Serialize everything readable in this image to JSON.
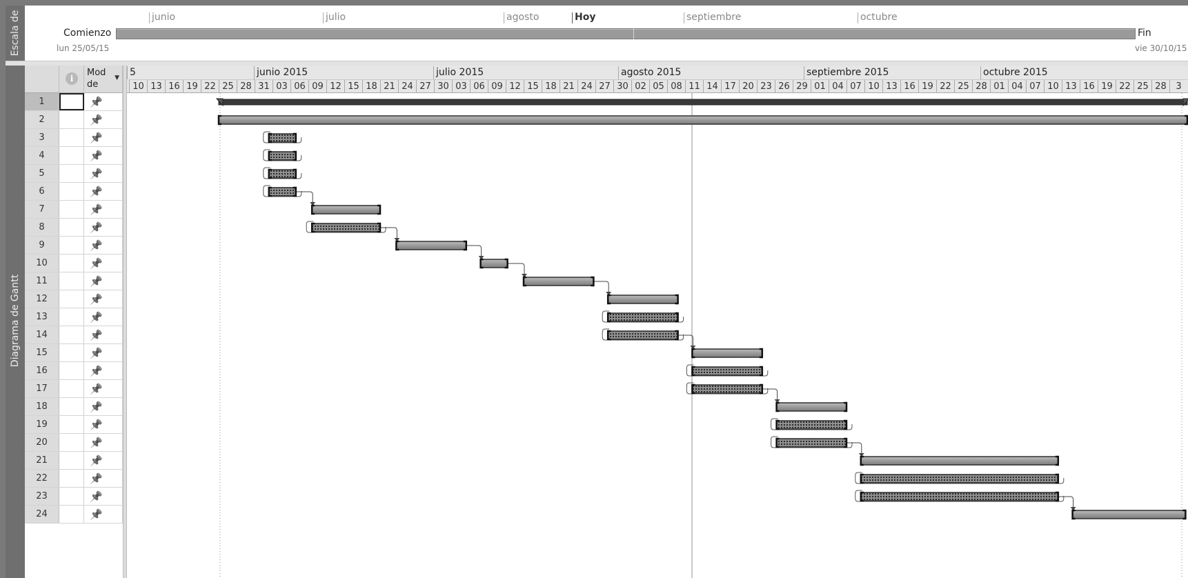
{
  "timeline": {
    "sidebar_label": "Escala de",
    "months": [
      "junio",
      "julio",
      "agosto",
      "septiembre",
      "octubre"
    ],
    "today_label": "Hoy",
    "start_label": "Comienzo",
    "start_date": "lun 25/05/15",
    "end_label": "Fin",
    "end_date": "vie 30/10/15"
  },
  "gantt": {
    "sidebar_label": "Diagrama de Gantt",
    "table": {
      "info_header": "i",
      "mode_header": "Mod de",
      "rows": [
        {
          "id": "1"
        },
        {
          "id": "2"
        },
        {
          "id": "3"
        },
        {
          "id": "4"
        },
        {
          "id": "5"
        },
        {
          "id": "6"
        },
        {
          "id": "7"
        },
        {
          "id": "8"
        },
        {
          "id": "9"
        },
        {
          "id": "10"
        },
        {
          "id": "11"
        },
        {
          "id": "12"
        },
        {
          "id": "13"
        },
        {
          "id": "14"
        },
        {
          "id": "15"
        },
        {
          "id": "16"
        },
        {
          "id": "17"
        },
        {
          "id": "18"
        },
        {
          "id": "19"
        },
        {
          "id": "20"
        },
        {
          "id": "21"
        },
        {
          "id": "22"
        },
        {
          "id": "23"
        },
        {
          "id": "24"
        }
      ]
    },
    "month_headers": [
      "5",
      "junio 2015",
      "julio 2015",
      "agosto 2015",
      "septiembre 2015",
      "octubre 2015"
    ],
    "day_headers": [
      "10",
      "13",
      "16",
      "19",
      "22",
      "25",
      "28",
      "31",
      "03",
      "06",
      "09",
      "12",
      "15",
      "18",
      "21",
      "24",
      "27",
      "30",
      "03",
      "06",
      "09",
      "12",
      "15",
      "18",
      "21",
      "24",
      "27",
      "30",
      "02",
      "05",
      "08",
      "11",
      "14",
      "17",
      "20",
      "23",
      "26",
      "29",
      "01",
      "04",
      "07",
      "10",
      "13",
      "16",
      "19",
      "22",
      "25",
      "28",
      "01",
      "04",
      "07",
      "10",
      "13",
      "16",
      "19",
      "22",
      "25",
      "28",
      "3"
    ],
    "today_day_index": 31,
    "project_start_day_index": 5,
    "tasks": [
      {
        "row": 1,
        "type": "summary",
        "start": 5,
        "end": 59
      },
      {
        "row": 2,
        "type": "task",
        "start": 5,
        "end": 59
      },
      {
        "row": 3,
        "type": "dotted",
        "start": 7.8,
        "end": 9.3
      },
      {
        "row": 4,
        "type": "dotted",
        "start": 7.8,
        "end": 9.3
      },
      {
        "row": 5,
        "type": "dotted",
        "start": 7.8,
        "end": 9.3
      },
      {
        "row": 6,
        "type": "dotted",
        "start": 7.8,
        "end": 9.3
      },
      {
        "row": 7,
        "type": "task",
        "start": 10.2,
        "end": 14.0
      },
      {
        "row": 8,
        "type": "dotted",
        "start": 10.2,
        "end": 14.0
      },
      {
        "row": 9,
        "type": "task",
        "start": 14.9,
        "end": 18.8
      },
      {
        "row": 10,
        "type": "task",
        "start": 19.6,
        "end": 21.1
      },
      {
        "row": 11,
        "type": "task",
        "start": 22.0,
        "end": 25.9
      },
      {
        "row": 12,
        "type": "task",
        "start": 26.7,
        "end": 30.6
      },
      {
        "row": 13,
        "type": "dotted",
        "start": 26.7,
        "end": 30.6
      },
      {
        "row": 14,
        "type": "dotted",
        "start": 26.7,
        "end": 30.6
      },
      {
        "row": 15,
        "type": "task",
        "start": 31.4,
        "end": 35.3
      },
      {
        "row": 16,
        "type": "dotted",
        "start": 31.4,
        "end": 35.3
      },
      {
        "row": 17,
        "type": "dotted",
        "start": 31.4,
        "end": 35.3
      },
      {
        "row": 18,
        "type": "task",
        "start": 36.1,
        "end": 40.0
      },
      {
        "row": 19,
        "type": "dotted",
        "start": 36.1,
        "end": 40.0
      },
      {
        "row": 20,
        "type": "dotted",
        "start": 36.1,
        "end": 40.0
      },
      {
        "row": 21,
        "type": "task",
        "start": 40.8,
        "end": 51.8
      },
      {
        "row": 22,
        "type": "dotted",
        "start": 40.8,
        "end": 51.8
      },
      {
        "row": 23,
        "type": "dotted",
        "start": 40.8,
        "end": 51.8
      },
      {
        "row": 24,
        "type": "task",
        "start": 52.6,
        "end": 58.9
      }
    ],
    "links": [
      {
        "from": 6,
        "to": 7
      },
      {
        "from": 8,
        "to": 9
      },
      {
        "from": 9,
        "to": 10
      },
      {
        "from": 10,
        "to": 11
      },
      {
        "from": 11,
        "to": 12
      },
      {
        "from": 14,
        "to": 15
      },
      {
        "from": 17,
        "to": 18
      },
      {
        "from": 20,
        "to": 21
      },
      {
        "from": 23,
        "to": 24
      }
    ],
    "loops": [
      3,
      4,
      5,
      6,
      8,
      13,
      14,
      16,
      17,
      19,
      20,
      22,
      23
    ]
  },
  "colors": {
    "sidebar": "#6f6f6f",
    "bar": "#9a9a9a",
    "bar_border": "#2f2f2f",
    "today_line": "#b5b5b5"
  }
}
